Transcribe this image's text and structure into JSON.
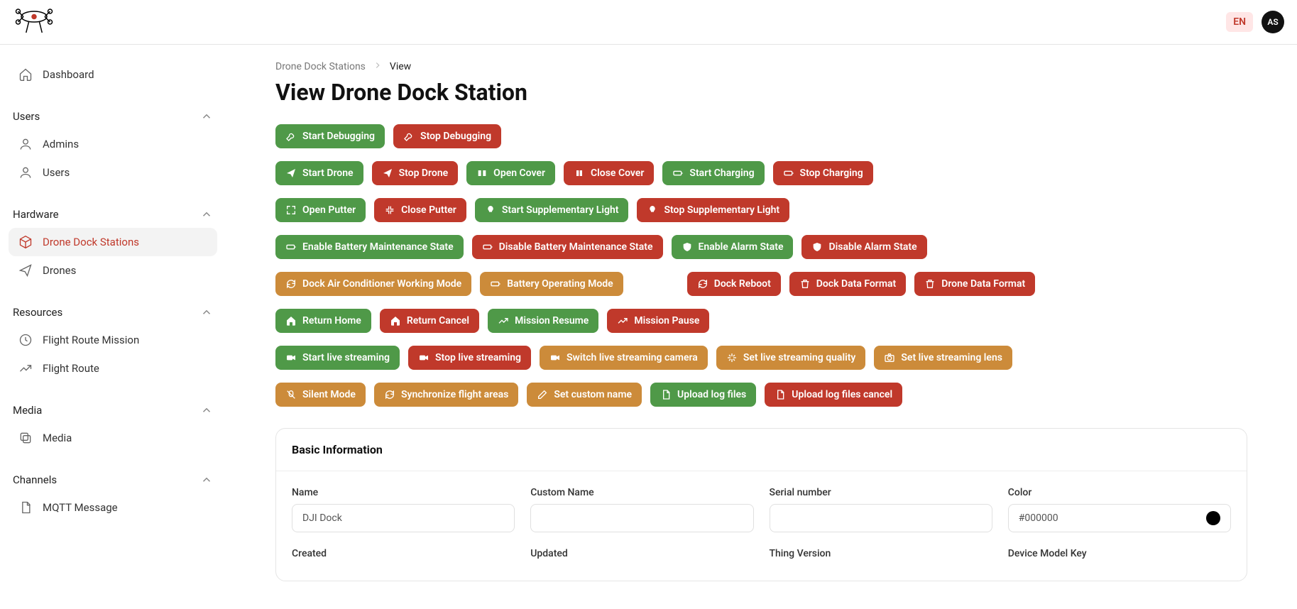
{
  "topbar": {
    "lang": "EN",
    "avatar_initials": "AS"
  },
  "sidebar": {
    "dashboard": "Dashboard",
    "group_users": "Users",
    "admins": "Admins",
    "users": "Users",
    "group_hardware": "Hardware",
    "drone_dock_stations": "Drone Dock Stations",
    "drones": "Drones",
    "group_resources": "Resources",
    "flight_route_mission": "Flight Route Mission",
    "flight_route": "Flight Route",
    "group_media": "Media",
    "media": "Media",
    "group_channels": "Channels",
    "mqtt_message": "MQTT Message"
  },
  "breadcrumb": {
    "a": "Drone Dock Stations",
    "b": "View"
  },
  "page_title": "View Drone Dock Station",
  "btn": {
    "start_debugging": "Start Debugging",
    "stop_debugging": "Stop Debugging",
    "start_drone": "Start Drone",
    "stop_drone": "Stop Drone",
    "open_cover": "Open Cover",
    "close_cover": "Close Cover",
    "start_charging": "Start Charging",
    "stop_charging": "Stop Charging",
    "open_putter": "Open Putter",
    "close_putter": "Close Putter",
    "start_supp_light": "Start Supplementary Light",
    "stop_supp_light": "Stop Supplementary Light",
    "enable_batt_maint": "Enable Battery Maintenance State",
    "disable_batt_maint": "Disable Battery Maintenance State",
    "enable_alarm": "Enable Alarm State",
    "disable_alarm": "Disable Alarm State",
    "dock_ac_mode": "Dock Air Conditioner Working Mode",
    "batt_op_mode": "Battery Operating Mode",
    "dock_reboot": "Dock Reboot",
    "dock_data_format": "Dock Data Format",
    "drone_data_format": "Drone Data Format",
    "return_home": "Return Home",
    "return_cancel": "Return Cancel",
    "mission_resume": "Mission Resume",
    "mission_pause": "Mission Pause",
    "start_live": "Start live streaming",
    "stop_live": "Stop live streaming",
    "switch_live_camera": "Switch live streaming camera",
    "set_live_quality": "Set live streaming quality",
    "set_live_lens": "Set live streaming lens",
    "silent_mode": "Silent Mode",
    "sync_flight_areas": "Synchronize flight areas",
    "set_custom_name": "Set custom name",
    "upload_log_files": "Upload log files",
    "upload_log_files_cancel": "Upload log files cancel"
  },
  "card": {
    "title": "Basic Information",
    "name_label": "Name",
    "name_value": "DJI Dock",
    "custom_name_label": "Custom Name",
    "custom_name_value": "",
    "serial_label": "Serial number",
    "serial_value": "",
    "color_label": "Color",
    "color_value": "#000000",
    "created_label": "Created",
    "updated_label": "Updated",
    "thing_version_label": "Thing Version",
    "device_model_key_label": "Device Model Key"
  }
}
